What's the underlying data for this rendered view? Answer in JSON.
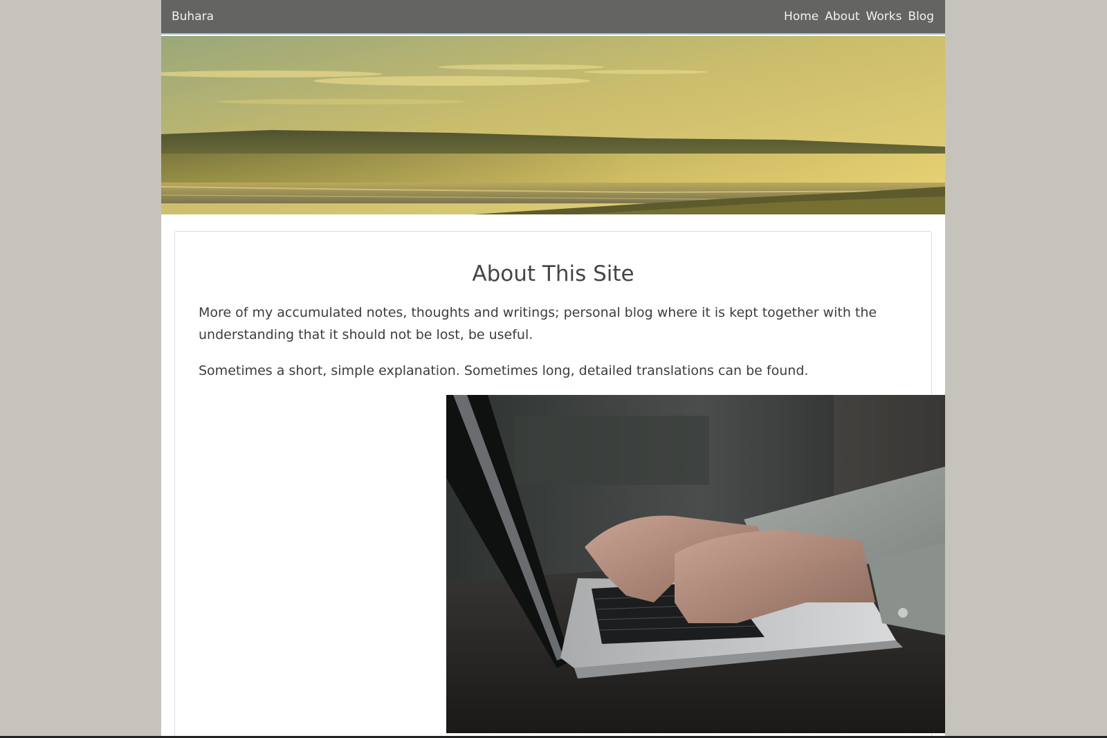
{
  "navbar": {
    "brand": "Buhara",
    "links": [
      "Home",
      "About",
      "Works",
      "Blog"
    ]
  },
  "hero": {
    "image": "golden-coastal-sunset-landscape"
  },
  "content": {
    "title": "About This Site",
    "paragraphs": [
      "More of my accumulated notes, thoughts and writings; personal blog where it is kept together with the understanding that it should not be lost, be useful.",
      "Sometimes a short, simple explanation. Sometimes long, detailed translations can be found."
    ],
    "image": "hands-typing-on-laptop"
  },
  "colors": {
    "background": "#c6c3bc",
    "navbar": "#646562",
    "navbar_border": "#9fc4d6",
    "nav_text": "#f2f2f0",
    "title_text": "#454545",
    "body_text": "#3c3c3c"
  }
}
